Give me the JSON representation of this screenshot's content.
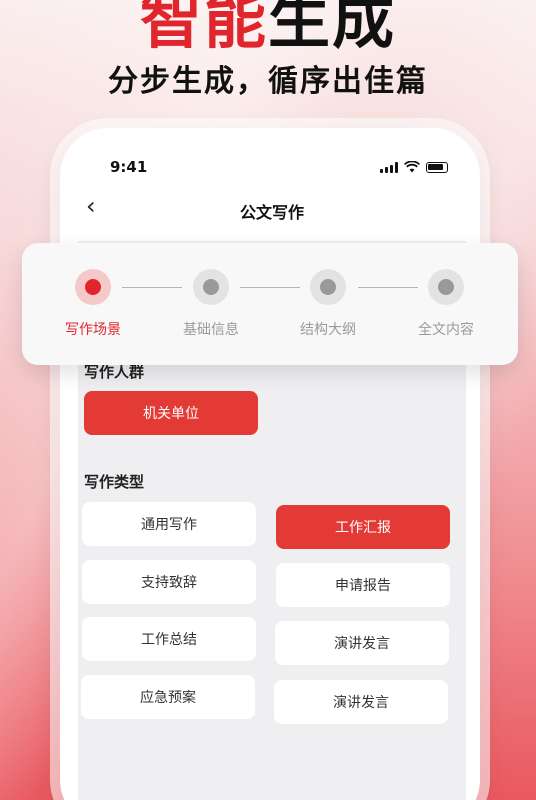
{
  "banner": {
    "headline_red": "智能",
    "headline_dark": "生成",
    "subline": "分步生成，循序出佳篇"
  },
  "status_bar": {
    "time": "9:41"
  },
  "nav": {
    "back": "‹",
    "title": "公文写作"
  },
  "steps": [
    {
      "label": "写作场景",
      "active": true
    },
    {
      "label": "基础信息",
      "active": false
    },
    {
      "label": "结构大纲",
      "active": false
    },
    {
      "label": "全文内容",
      "active": false
    }
  ],
  "audience": {
    "title": "写作人群",
    "options": [
      {
        "label": "机关单位",
        "selected": true
      }
    ]
  },
  "types": {
    "title": "写作类型",
    "options": [
      {
        "label": "通用写作",
        "selected": false
      },
      {
        "label": "工作汇报",
        "selected": true
      },
      {
        "label": "支持致辞",
        "selected": false
      },
      {
        "label": "申请报告",
        "selected": false
      },
      {
        "label": "工作总结",
        "selected": false
      },
      {
        "label": "演讲发言",
        "selected": false
      },
      {
        "label": "应急预案",
        "selected": false
      },
      {
        "label": "演讲发言",
        "selected": false
      }
    ]
  },
  "colors": {
    "accent": "#e0262c",
    "chip_selected": "#e43a36"
  }
}
